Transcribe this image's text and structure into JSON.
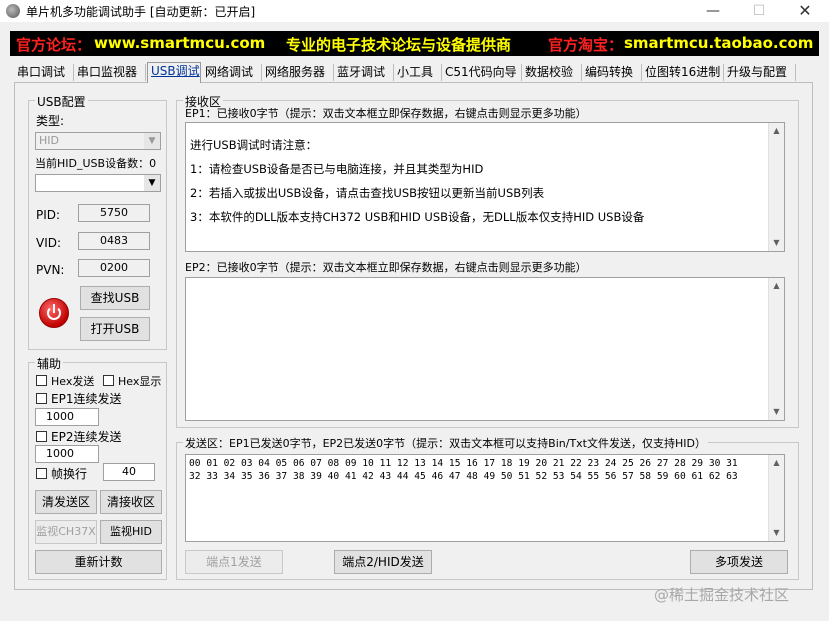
{
  "window": {
    "title": "单片机多功能调试助手 [自动更新：已开启]",
    "min": "—",
    "max": "☐",
    "close": "✕"
  },
  "banner": {
    "forum_label": "官方论坛：",
    "forum_url": "www.smartmcu.com",
    "slogan": "专业的电子技术论坛与设备提供商",
    "shop_label": "官方淘宝：",
    "shop_url": "smartmcu.taobao.com"
  },
  "tabs": [
    "串口调试",
    "串口监视器",
    "USB调试",
    "网络调试",
    "网络服务器",
    "蓝牙调试",
    "小工具",
    "C51代码向导",
    "数据校验",
    "编码转换",
    "位图转16进制",
    "升级与配置"
  ],
  "usb_config": {
    "title": "USB配置",
    "type_label": "类型:",
    "type_value": "HID",
    "device_count_label": "当前HID_USB设备数：0",
    "device_value": "",
    "pid_label": "PID:",
    "pid_value": "5750",
    "vid_label": "VID:",
    "vid_value": "0483",
    "pvn_label": "PVN:",
    "pvn_value": "0200",
    "find_btn": "查找USB",
    "open_btn": "打开USB"
  },
  "aux": {
    "title": "辅助",
    "hex_send": "Hex发送",
    "hex_show": "Hex显示",
    "ep1_cont": "EP1连续发送",
    "ep1_interval": "1000",
    "ep2_cont": "EP2连续发送",
    "ep2_interval": "1000",
    "frame_wrap": "帧换行",
    "frame_value": "40",
    "clear_send": "清发送区",
    "clear_recv": "清接收区",
    "monitor_ch37x": "监视CH37X",
    "monitor_hid": "监视HID",
    "reset_count": "重新计数"
  },
  "recv": {
    "title": "接收区",
    "ep1_label": "EP1：已接收0字节（提示：双击文本框立即保存数据，右键点击则显示更多功能）",
    "ep1_lines": [
      "进行USB调试时请注意：",
      "1：请检查USB设备是否已与电脑连接，并且其类型为HID",
      "2：若插入或拔出USB设备，请点击查找USB按钮以更新当前USB列表",
      "3：本软件的DLL版本支持CH372 USB和HID USB设备，无DLL版本仅支持HID USB设备"
    ],
    "ep2_label": "EP2：已接收0字节（提示：双击文本框立即保存数据，右键点击则显示更多功能）"
  },
  "send": {
    "title": "发送区：EP1已发送0字节，EP2已发送0字节（提示：双击文本框可以支持Bin/Txt文件发送，仅支持HID）",
    "hex_lines": [
      "00 01 02 03 04 05 06 07 08 09 10 11 12 13 14 15 16 17 18 19 20 21 22 23 24 25 26 27 28 29 30 31",
      "32 33 34 35 36 37 38 39 40 41 42 43 44 45 46 47 48 49 50 51 52 53 54 55 56 57 58 59 60 61 62 63"
    ],
    "ep1_btn": "端点1发送",
    "ep2_btn": "端点2/HID发送",
    "multi_btn": "多项发送"
  },
  "watermark": "@稀土掘金技术社区"
}
